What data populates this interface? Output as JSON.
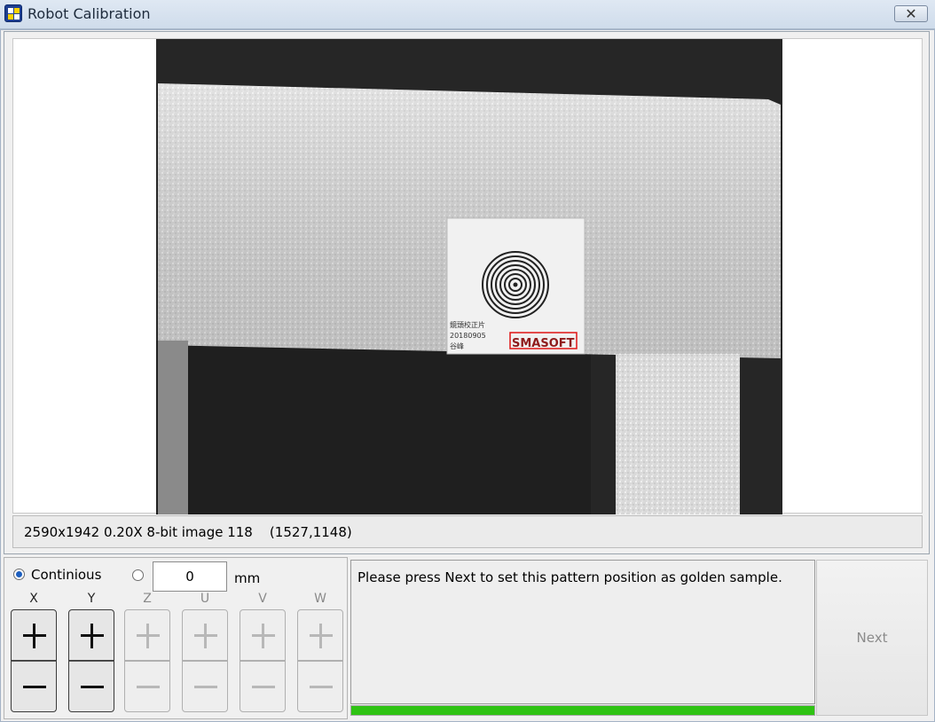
{
  "window": {
    "title": "Robot Calibration",
    "close_icon": "close-icon",
    "app_icon": "app-icon"
  },
  "viewer": {
    "status": "2590x1942 0.20X 8-bit image 118    (1527,1148)",
    "target_label_lines": [
      "鏡頭校正片",
      "20180905",
      "谷峰"
    ],
    "target_logo": "SMASOFT"
  },
  "jog": {
    "mode_continuous_label": "Continious",
    "mode_continuous_selected": true,
    "step_value": "0",
    "step_unit": "mm",
    "axes": [
      {
        "label": "X",
        "enabled": true
      },
      {
        "label": "Y",
        "enabled": true
      },
      {
        "label": "Z",
        "enabled": false
      },
      {
        "label": "U",
        "enabled": false
      },
      {
        "label": "V",
        "enabled": false
      },
      {
        "label": "W",
        "enabled": false
      }
    ]
  },
  "message": {
    "text": "Please press Next to set this pattern position as golden sample."
  },
  "progress": {
    "fraction": 1.0,
    "color": "#2fc314"
  },
  "next": {
    "label": "Next",
    "enabled": false
  }
}
